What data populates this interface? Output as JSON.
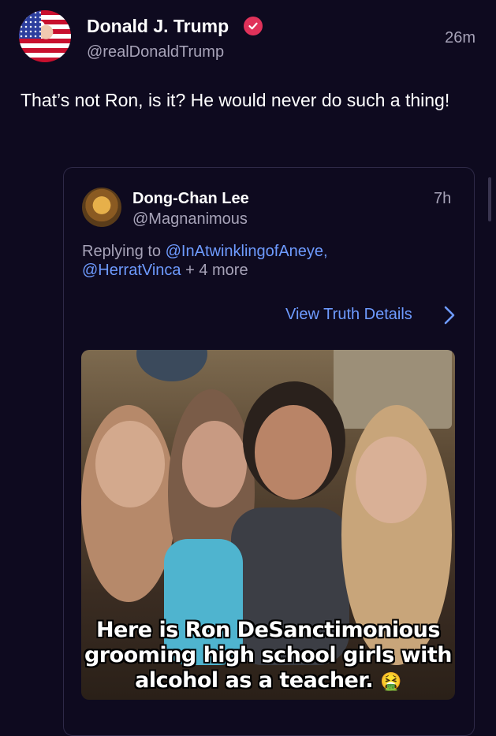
{
  "post": {
    "author_name": "Donald J. Trump",
    "author_handle": "@realDonaldTrump",
    "time": "26m",
    "text": "That’s not Ron, is it? He would never do such a thing!"
  },
  "quoted": {
    "author_name": "Dong-Chan Lee",
    "author_handle": "@Magnanimous",
    "time": "7h",
    "replying_prefix": "Replying to ",
    "reply_mention_1": "@InAtwinklingofAneye,",
    "reply_mention_2": "@HerratVinca",
    "reply_more": " + 4 more",
    "view_details": "View Truth Details",
    "media_caption_1": "Here is Ron DeSanctimonious",
    "media_caption_2": "grooming high school girls with",
    "media_caption_3": "alcohol as a teacher.",
    "media_emoji": "🤮"
  },
  "colors": {
    "background": "#0e0a1f",
    "link": "#6e9bff",
    "muted": "#a7a3b8",
    "verified": "#e0325a"
  }
}
